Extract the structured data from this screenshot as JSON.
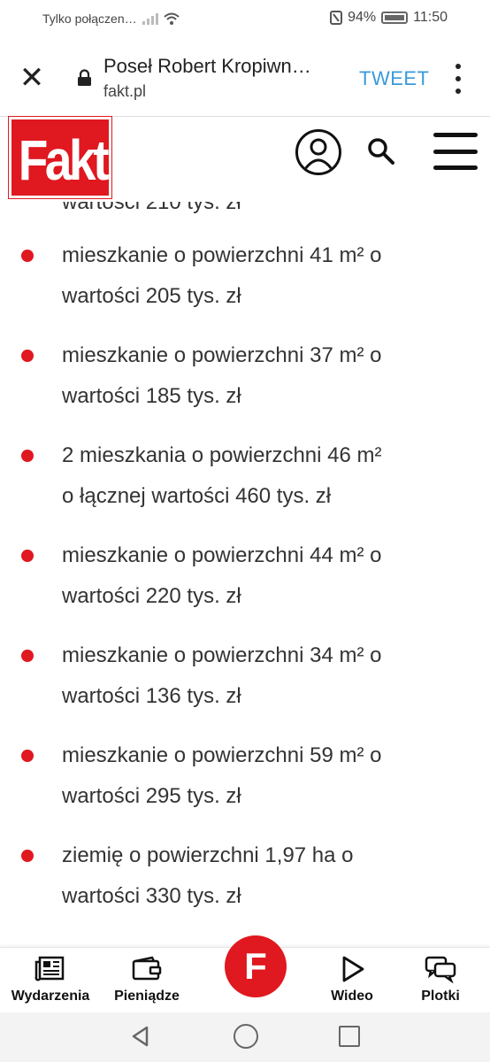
{
  "status_bar": {
    "carrier_text": "Tylko połączen…",
    "battery_percent": "94%",
    "time": "11:50"
  },
  "browser": {
    "page_title": "Poseł Robert Kropiwn…",
    "url": "fakt.pl",
    "tweet_label": "TWEET"
  },
  "site": {
    "logo_text": "Fakt",
    "brand_color": "#e0181f"
  },
  "content": {
    "partial_line": "wartości 210 tys. zł",
    "items": [
      {
        "line1": "mieszkanie o powierzchni 41 m² o",
        "line2": "wartości 205 tys. zł"
      },
      {
        "line1": "mieszkanie o powierzchni 37 m² o",
        "line2": "wartości 185 tys. zł"
      },
      {
        "line1": "2 mieszkania o powierzchni 46 m²",
        "line2": "o łącznej wartości 460 tys. zł"
      },
      {
        "line1": "mieszkanie o powierzchni 44 m² o",
        "line2": "wartości 220 tys. zł"
      },
      {
        "line1": "mieszkanie o powierzchni 34 m² o",
        "line2": "wartości 136 tys. zł"
      },
      {
        "line1": "mieszkanie o powierzchni 59 m² o",
        "line2": "wartości 295 tys. zł"
      },
      {
        "line1": "ziemię o powierzchni 1,97 ha o",
        "line2": "wartości 330 tys. zł"
      }
    ]
  },
  "bottom_nav": {
    "items": [
      {
        "label": "Wydarzenia",
        "icon": "newspaper-icon"
      },
      {
        "label": "Pieniądze",
        "icon": "wallet-icon"
      },
      {
        "label": "F",
        "icon": "fakt-f-icon"
      },
      {
        "label": "Wideo",
        "icon": "play-icon"
      },
      {
        "label": "Plotki",
        "icon": "chat-bubbles-icon"
      }
    ]
  }
}
